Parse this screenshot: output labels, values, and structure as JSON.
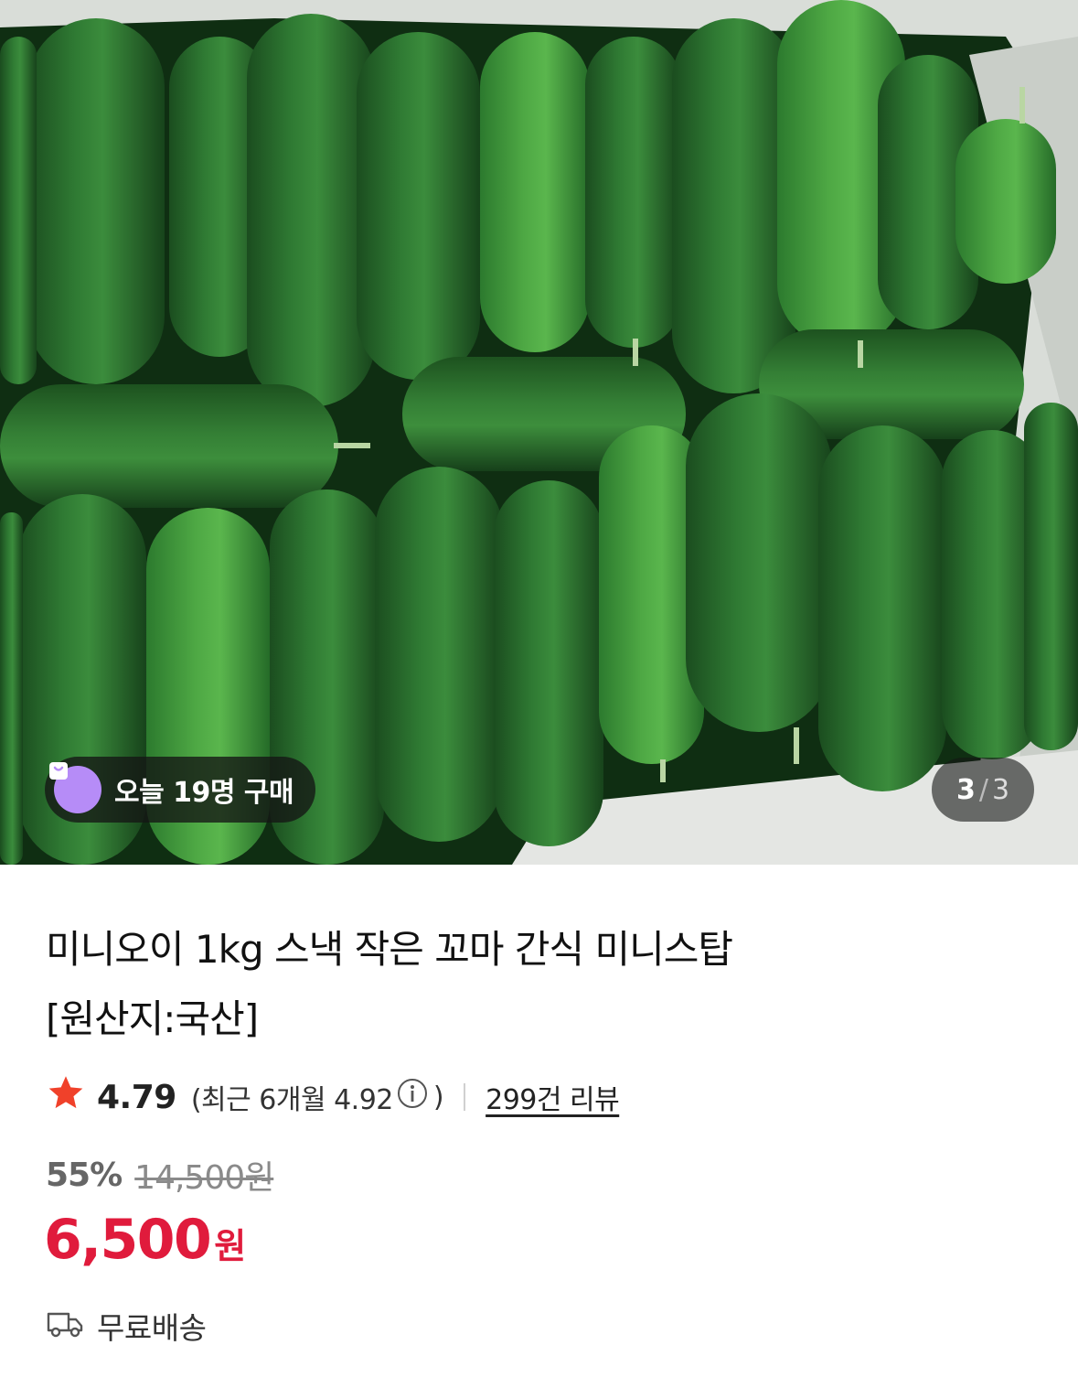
{
  "gallery": {
    "buyers_badge": "오늘 19명 구매",
    "pager": {
      "current": "3",
      "separator": "/",
      "total": "3"
    }
  },
  "product": {
    "title_line1": "미니오이 1kg 스낵 작은 꼬마 간식 미니스탑",
    "title_line2": "[원산지:국산]"
  },
  "rating": {
    "score": "4.79",
    "recent_label": "(최근 6개월 4.92",
    "recent_close": ")",
    "reviews": "299건 리뷰"
  },
  "price": {
    "discount": "55%",
    "original": "14,500원",
    "sale_amount": "6,500",
    "sale_unit": "원"
  },
  "shipping": {
    "label": "무료배송"
  },
  "colors": {
    "accent_red": "#e01b3c",
    "star": "#f0412a",
    "badge_icon": "#b68cf7"
  },
  "icons": {
    "rating": "star-icon",
    "recent_info": "info-icon",
    "shipping": "truck-icon",
    "badge": "shopping-bag-icon"
  }
}
